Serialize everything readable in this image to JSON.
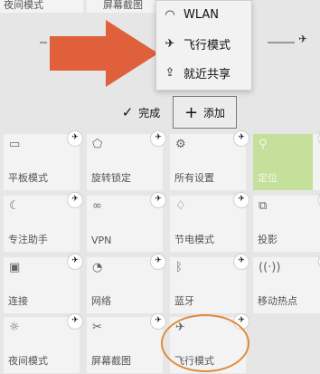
{
  "top_row": [
    {
      "label": "夜间模式"
    },
    {
      "label": "屏幕截图"
    }
  ],
  "menu": {
    "items": [
      {
        "icon": "wifi-icon",
        "glyph": "◠",
        "label": "WLAN"
      },
      {
        "icon": "airplane-icon",
        "glyph": "✈",
        "label": "飞行模式"
      },
      {
        "icon": "nearby-share-icon",
        "glyph": "⇪",
        "label": "就近共享"
      }
    ]
  },
  "actions": {
    "done_label": "完成",
    "add_label": "添加",
    "done_glyph": "✓",
    "add_glyph": "+"
  },
  "tiles": [
    {
      "label": "平板模式",
      "icon": "tablet-icon",
      "glyph": "▭"
    },
    {
      "label": "旋转锁定",
      "icon": "rotation-lock-icon",
      "glyph": "⬠"
    },
    {
      "label": "所有设置",
      "icon": "gear-icon",
      "glyph": "⚙"
    },
    {
      "label": "定位",
      "icon": "location-icon",
      "glyph": "⚲",
      "active": true
    },
    {
      "label": "",
      "icon": "partial-tile-icon",
      "glyph": ""
    },
    {
      "label": "专注助手",
      "icon": "moon-icon",
      "glyph": "☾"
    },
    {
      "label": "VPN",
      "icon": "vpn-icon",
      "glyph": "∞"
    },
    {
      "label": "节电模式",
      "icon": "battery-saver-icon",
      "glyph": "♢"
    },
    {
      "label": "投影",
      "icon": "project-icon",
      "glyph": "⧉"
    },
    {
      "label": "",
      "icon": "partial-tile-icon",
      "glyph": ""
    },
    {
      "label": "连接",
      "icon": "connect-icon",
      "glyph": "▣"
    },
    {
      "label": "网络",
      "icon": "network-icon",
      "glyph": "◔"
    },
    {
      "label": "蓝牙",
      "icon": "bluetooth-icon",
      "glyph": "ᛒ"
    },
    {
      "label": "移动热点",
      "icon": "hotspot-icon",
      "glyph": "((·))"
    },
    {
      "label": "",
      "icon": "partial-tile-icon",
      "glyph": ""
    },
    {
      "label": "夜间模式",
      "icon": "night-light-icon",
      "glyph": "☼"
    },
    {
      "label": "屏幕截图",
      "icon": "screen-snip-icon",
      "glyph": "✂"
    },
    {
      "label": "飞行模式",
      "icon": "airplane-icon",
      "glyph": "✈"
    }
  ],
  "pin_glyph": "✈",
  "colors": {
    "accent_tile": "#c5e09b",
    "arrow": "#e0603c",
    "highlight_circle": "#e08b3c"
  }
}
